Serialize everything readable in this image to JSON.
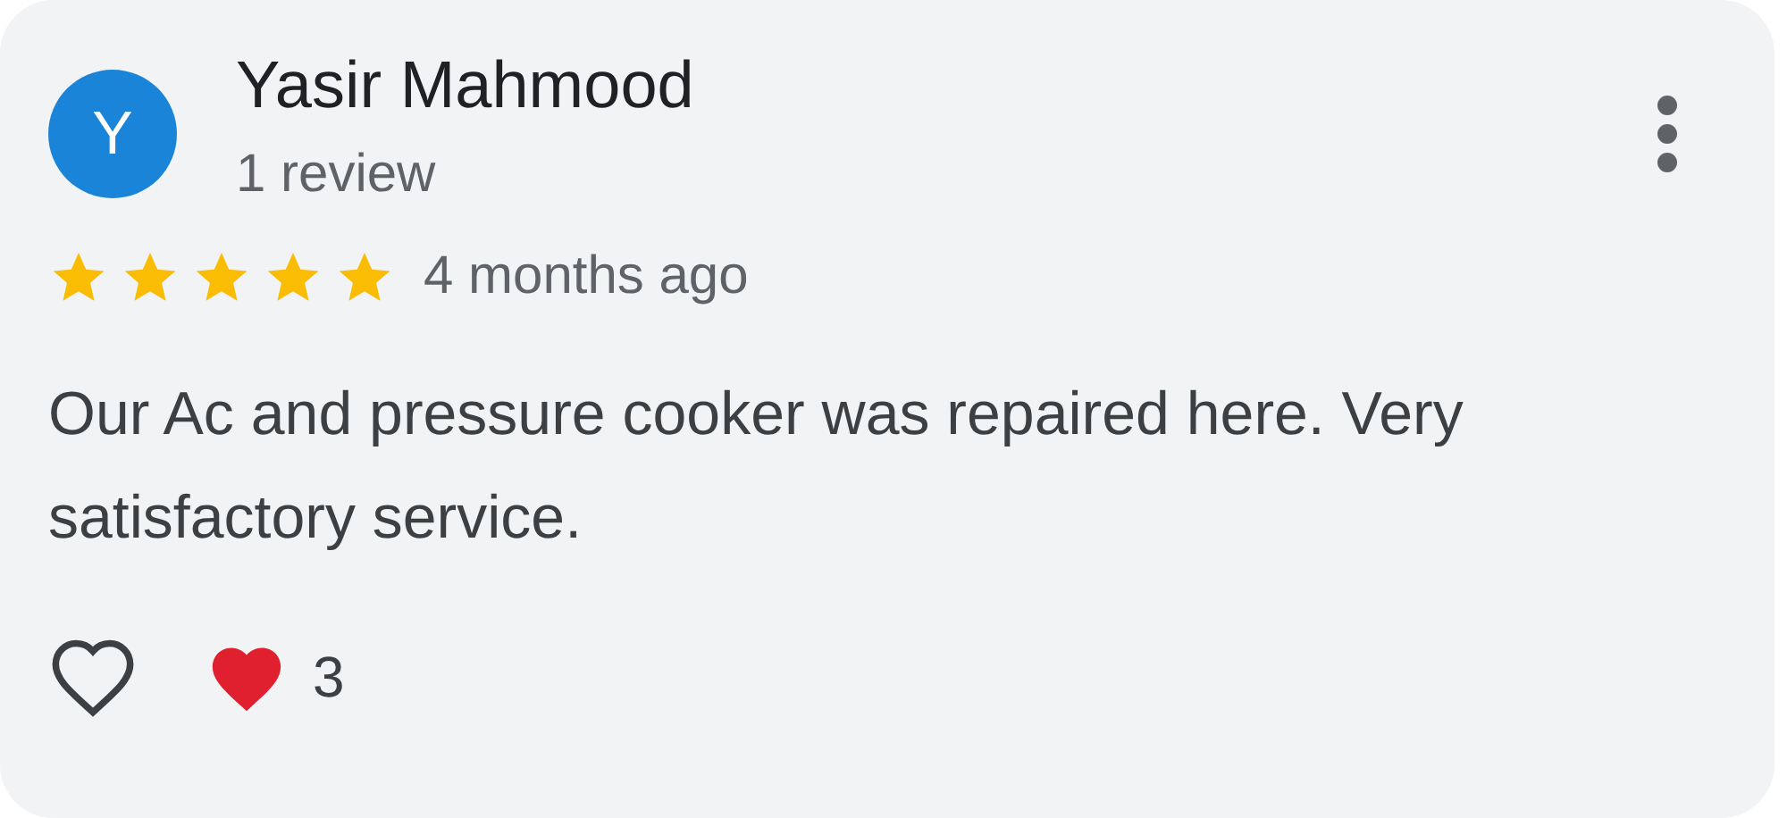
{
  "review": {
    "avatar_letter": "Y",
    "author": "Yasir Mahmood",
    "review_count": "1 review",
    "stars": 5,
    "time": "4 months ago",
    "text": "Our Ac and pressure cooker was repaired here. Very satisfactory service.",
    "liked": false,
    "reaction_count": "3"
  }
}
